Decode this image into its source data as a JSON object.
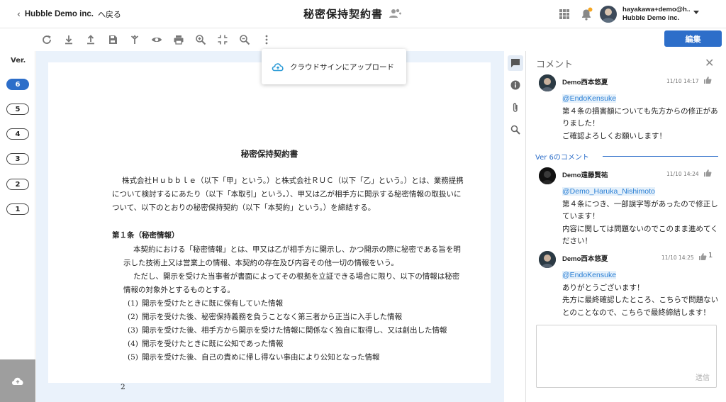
{
  "header": {
    "org_name": "Hubble Demo inc.",
    "back_label": "へ戻る",
    "doc_title": "秘密保持契約書",
    "user_email": "hayakawa+demo@h...",
    "user_org": "Hubble Demo inc."
  },
  "toolbar": {
    "icons": [
      "refresh-icon",
      "download-icon",
      "upload-icon",
      "save-icon",
      "merge-icon",
      "eye-icon",
      "print-icon",
      "zoom-in-icon",
      "fit-icon",
      "zoom-out-icon",
      "more-icon"
    ],
    "edit_label": "編集"
  },
  "popup": {
    "upload_label": "クラウドサインにアップロード"
  },
  "versions": {
    "label": "Ver.",
    "items": [
      "6",
      "5",
      "4",
      "3",
      "2",
      "1"
    ],
    "active": "6"
  },
  "document": {
    "title": "秘密保持契約書",
    "intro": "株式会社Ｈｕｂｂｌｅ（以下「甲」という。）と株式会社ＲＵＣ（以下「乙」という。）とは、業務提携について検討するにあたり（以下「本取引」という。）、甲又は乙が相手方に開示する秘密情報の取扱いについて、以下のとおりの秘密保持契約（以下「本契約」という。）を締結する。",
    "article1_heading": "第１条（秘密情報）",
    "article1_p1": "本契約における「秘密情報」とは、甲又は乙が相手方に開示し、かつ開示の際に秘密である旨を明示した技術上又は営業上の情報、本契約の存在及び内容その他一切の情報をいう。",
    "article1_p2": "ただし、開示を受けた当事者が書面によってその根拠を立証できる場合に限り、以下の情報は秘密情報の対象外とするものとする。",
    "items": [
      {
        "num": "(1)",
        "text": "開示を受けたときに既に保有していた情報"
      },
      {
        "num": "(2)",
        "text": "開示を受けた後、秘密保持義務を負うことなく第三者から正当に入手した情報"
      },
      {
        "num": "(3)",
        "text": "開示を受けた後、相手方から開示を受けた情報に関係なく独自に取得し、又は創出した情報"
      },
      {
        "num": "(4)",
        "text": "開示を受けたときに既に公知であった情報"
      },
      {
        "num": "(5)",
        "text": "開示を受けた後、自己の責めに帰し得ない事由により公知となった情報"
      }
    ],
    "page_number": "2"
  },
  "comments": {
    "title": "コメント",
    "version_separator": "Ver 6のコメント",
    "list": [
      {
        "name": "Demo西本悠夏",
        "time": "11/10 14:17",
        "likes": "",
        "mention": "@EndoKensuke",
        "text": "第４条の損害額についても先方からの修正がありました！\nご確認よろしくお願いします！"
      },
      {
        "name": "Demo遠藤賢祐",
        "time": "11/10 14:24",
        "likes": "",
        "mention": "@Demo_Haruka_Nishimoto",
        "text": "第４条につき、一部誤字等があったので修正しています！\n内容に関しては問題ないのでこのまま進めてください！"
      },
      {
        "name": "Demo西本悠夏",
        "time": "11/10 14:25",
        "likes": "1",
        "mention": "@EndoKensuke",
        "text": "ありがとうございます！\n先方に最終確認したところ、こちらで問題ないとのことなので、こちらで最終締結します！"
      }
    ],
    "reply_placeholder": "",
    "send_label": "送信"
  },
  "colors": {
    "accent": "#2d6ec9",
    "viewer_bg": "#eaf2fb",
    "mention": "#2a7fd4",
    "notification_dot": "#f5a623"
  }
}
